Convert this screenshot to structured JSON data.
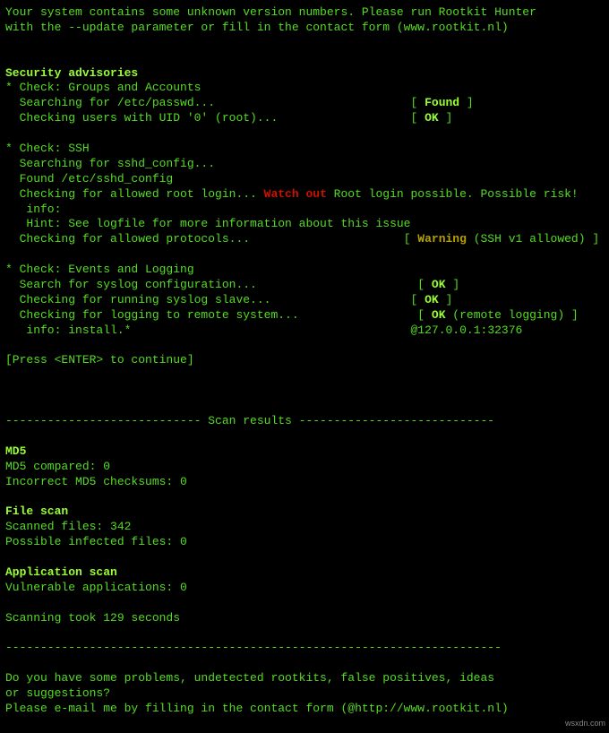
{
  "header": {
    "line1": "Your system contains some unknown version numbers. Please run Rootkit Hunter",
    "line2": "with the --update parameter or fill in the contact form (www.rootkit.nl)"
  },
  "sections": {
    "security_advisories_title": "Security advisories",
    "check_groups": "* Check: Groups and Accounts",
    "search_passwd": "  Searching for /etc/passwd...",
    "search_passwd_status_open": "[ ",
    "search_passwd_status": "Found",
    "search_passwd_status_close": " ]",
    "check_uid": "  Checking users with UID '0' (root)...",
    "check_uid_status": "OK",
    "check_ssh": "* Check: SSH",
    "search_sshd": "  Searching for sshd_config...",
    "found_sshd": "  Found /etc/sshd_config",
    "check_root_login_pre": "  Checking for allowed root login... ",
    "watch_out": "Watch out",
    "check_root_login_post": " Root login possible. Possible risk!",
    "info_label": "   info:",
    "hint": "   Hint: See logfile for more information about this issue",
    "check_protocols": "  Checking for allowed protocols...",
    "warning": "Warning",
    "protocols_detail": " (SSH v1 allowed) ]",
    "check_events": "* Check: Events and Logging",
    "search_syslog": "  Search for syslog configuration...",
    "syslog_status": "OK",
    "check_slave": "  Checking for running syslog slave...",
    "slave_status": "OK",
    "check_remote": "  Checking for logging to remote system...",
    "remote_status": "OK",
    "remote_detail": " (remote logging) ]",
    "info_install": "   info: install.*",
    "remote_addr": "@127.0.0.1:32376",
    "press_enter": "[Press <ENTER> to continue]",
    "results_divider": "---------------------------- Scan results ----------------------------",
    "md5_title": "MD5",
    "md5_compared": "MD5 compared: 0",
    "md5_incorrect": "Incorrect MD5 checksums: 0",
    "filescan_title": "File scan",
    "scanned_files": "Scanned files: 342",
    "infected": "Possible infected files: 0",
    "appscan_title": "Application scan",
    "vulnerable": "Vulnerable applications: 0",
    "scan_time": "Scanning took 129 seconds",
    "footer_divider": "-----------------------------------------------------------------------",
    "footer1": "Do you have some problems, undetected rootkits, false positives, ideas",
    "footer2": "or suggestions?",
    "footer3": "Please e-mail me by filling in the contact form (@http://www.rootkit.nl)"
  },
  "watermark": "wsxdn.com"
}
